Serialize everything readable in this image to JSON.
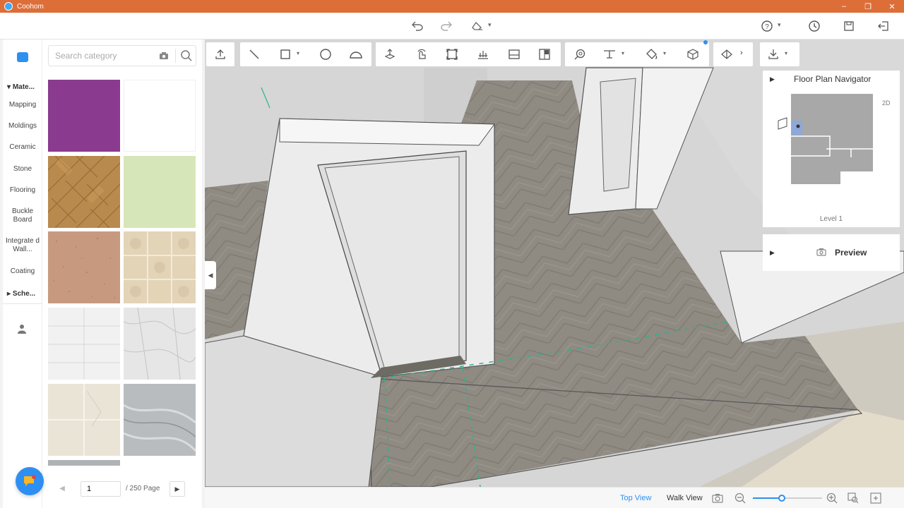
{
  "app": {
    "name": "Coohom"
  },
  "window_controls": [
    "–",
    "❐",
    "✕"
  ],
  "topbar": {
    "undo_icon": "undo-icon",
    "redo_icon": "redo-icon",
    "eraser_icon": "eraser-icon",
    "help_icon": "help-icon",
    "history_icon": "clock-icon",
    "save_icon": "save-icon",
    "exit_icon": "exit-icon"
  },
  "rail": {
    "header": "Mate...",
    "items": [
      "Mapping",
      "Moldings",
      "Ceramic",
      "Stone",
      "Flooring",
      "Buckle Board",
      "Integrate d Wall...",
      "Coating"
    ],
    "scheme": "Sche..."
  },
  "search": {
    "placeholder": "Search category",
    "value": ""
  },
  "swatches": [
    {
      "name": "purple",
      "color": "#8a3a8f"
    },
    {
      "name": "white",
      "color": "#ffffff"
    },
    {
      "name": "herringbone-wood",
      "color": "#b98a4e"
    },
    {
      "name": "light-green",
      "color": "#d7e6b8"
    },
    {
      "name": "terrazzo",
      "color": "#c79a80"
    },
    {
      "name": "beige-tile",
      "color": "#e3d4b8"
    },
    {
      "name": "white-tile",
      "color": "#f1f1f1"
    },
    {
      "name": "white-marble",
      "color": "#e6e6e6"
    },
    {
      "name": "cream-marble",
      "color": "#e9e4d6"
    },
    {
      "name": "grey-marble",
      "color": "#b8bcbf"
    }
  ],
  "pager": {
    "current": "1",
    "total_label": "/ 250 Page",
    "prev": "◀",
    "next": "▶"
  },
  "navigator": {
    "title": "Floor Plan Navigator",
    "mode": "2D",
    "level": "Level 1"
  },
  "preview": {
    "label": "Preview"
  },
  "bottombar": {
    "tabs": [
      {
        "label": "Top View",
        "active": true
      },
      {
        "label": "Walk View",
        "active": false
      }
    ],
    "zoom_level": 0.42
  },
  "colors": {
    "titlebar": "#dd6e38",
    "accent": "#2e8ff2",
    "floor": "#8f8a82",
    "wall": "#ececec"
  }
}
